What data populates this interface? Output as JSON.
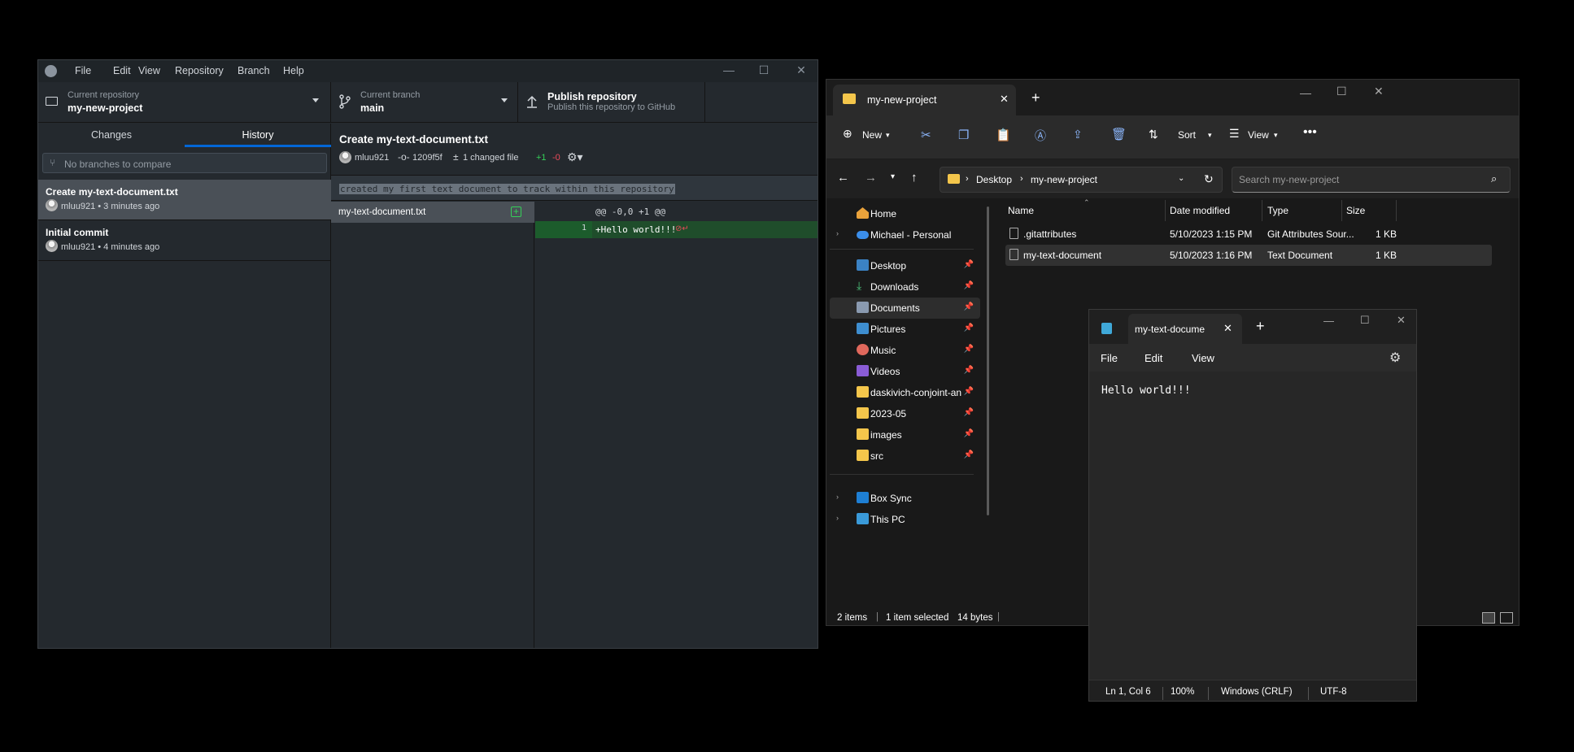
{
  "github_desktop": {
    "menu": [
      "File",
      "Edit",
      "View",
      "Repository",
      "Branch",
      "Help"
    ],
    "repo_label": "Current repository",
    "repo_value": "my-new-project",
    "branch_label": "Current branch",
    "branch_value": "main",
    "publish_title": "Publish repository",
    "publish_sub": "Publish this repository to GitHub",
    "tabs": [
      "Changes",
      "History"
    ],
    "compare_placeholder": "No branches to compare",
    "commits": [
      {
        "title": "Create my-text-document.txt",
        "author": "mluu921",
        "time": "• 3 minutes ago"
      },
      {
        "title": "Initial commit",
        "author": "mluu921",
        "time": "• 4 minutes ago"
      }
    ],
    "detail": {
      "title": "Create my-text-document.txt",
      "author": "mluu921",
      "sha": "1209f5f",
      "changed": "1 changed file",
      "additions": "+1",
      "deletions": "-0",
      "description": "created my first text document to track within this repository",
      "file": "my-text-document.txt",
      "hunk_header": "@@ -0,0 +1 @@",
      "line_no": "1",
      "line_text": "+Hello world!!!"
    }
  },
  "explorer": {
    "tab_title": "my-new-project",
    "cmd": {
      "new": "New",
      "sort": "Sort",
      "view": "View"
    },
    "breadcrumb": [
      "Desktop",
      "my-new-project"
    ],
    "search_placeholder": "Search my-new-project",
    "nav": {
      "home": "Home",
      "onedrive": "Michael - Personal",
      "quick": [
        "Desktop",
        "Downloads",
        "Documents",
        "Pictures",
        "Music",
        "Videos",
        "daskivich-conjoint-an",
        "2023-05",
        "images",
        "src"
      ],
      "box": "Box Sync",
      "pc": "This PC"
    },
    "columns": [
      "Name",
      "Date modified",
      "Type",
      "Size"
    ],
    "files": [
      {
        "name": ".gitattributes",
        "date": "5/10/2023 1:15 PM",
        "type": "Git Attributes Sour...",
        "size": "1 KB"
      },
      {
        "name": "my-text-document",
        "date": "5/10/2023 1:16 PM",
        "type": "Text Document",
        "size": "1 KB"
      }
    ],
    "status": {
      "items": "2 items",
      "selected": "1 item selected",
      "size": "14 bytes"
    }
  },
  "notepad": {
    "tab_title": "my-text-docume",
    "menu": [
      "File",
      "Edit",
      "View"
    ],
    "content": "Hello world!!!",
    "status": {
      "pos": "Ln 1, Col 6",
      "zoom": "100%",
      "eol": "Windows (CRLF)",
      "enc": "UTF-8"
    }
  }
}
